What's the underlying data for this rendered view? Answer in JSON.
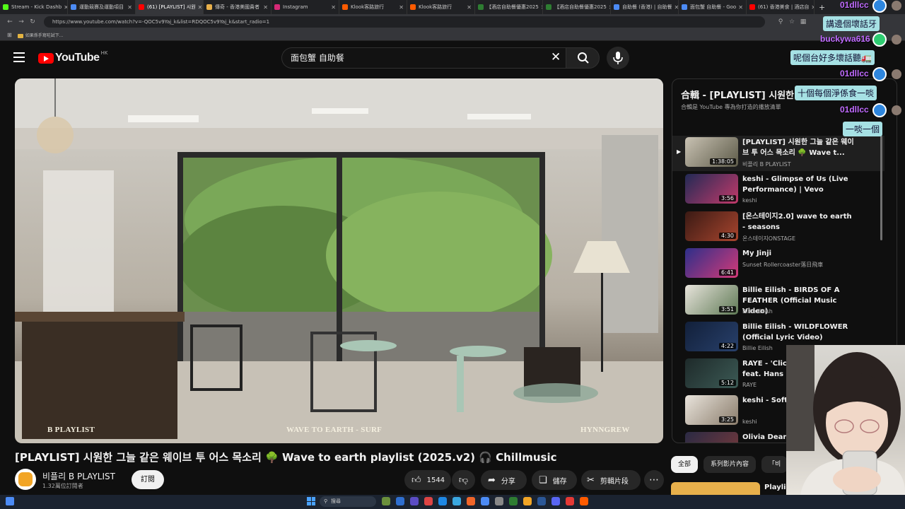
{
  "browser": {
    "tabs": [
      {
        "title": "Stream - Kick Dashb",
        "color": "#53fc18"
      },
      {
        "title": "運動競賽及運動項目",
        "color": "#4c8bf5"
      },
      {
        "title": "(61) [PLAYLIST] 시원",
        "color": "#ff0000",
        "active": true
      },
      {
        "title": "傳奇 - 香港美國貴者",
        "color": "#e8b04b"
      },
      {
        "title": "Instagram",
        "color": "#d62976"
      },
      {
        "title": "Klook客路旅行",
        "color": "#ff5b00"
      },
      {
        "title": "Klook客路旅行",
        "color": "#ff5b00"
      },
      {
        "title": "【酒店自助餐優惠2025",
        "color": "#2e7d32"
      },
      {
        "title": "【酒店自助餐優惠2025",
        "color": "#2e7d32"
      },
      {
        "title": "自助餐 (香港) | 自助餐",
        "color": "#4c8bf5"
      },
      {
        "title": "面包蟹 自助餐 - Goo",
        "color": "#4c8bf5"
      },
      {
        "title": "(61) 香港美食 | 酒店自",
        "color": "#ff0000"
      }
    ],
    "url": "https://www.youtube.com/watch?v=-QOC5v9Yaj_k&list=RDQOC5v9Yaj_k&start_radio=1",
    "bookmark": "如果係手寫咗試下..."
  },
  "youtube": {
    "logo_text": "YouTube",
    "region": "HK",
    "search_value": "面包蟹 自助餐",
    "video": {
      "overlay_left": "B PLAYLIST",
      "overlay_center": "WAVE TO EARTH - SURF",
      "overlay_right": "HYNNGREW",
      "title": "[PLAYLIST] 시원한 그늘 같은 웨이브 투 어스 목소리 🌳 Wave to earth playlist (2025.v2) 🎧 Chillmusic",
      "channel": "비플리 B PLAYLIST",
      "subscribers": "1.32萬位訂閱者",
      "subscribe": "訂閱",
      "likes": "1544",
      "share": "分享",
      "save": "儲存",
      "clip": "剪輯片段"
    },
    "playlist": {
      "title": "合輯 - [PLAYLIST] 시원한 그늘 같은",
      "subtitle": "合輯是 YouTube 專為你打造的播放清單",
      "items": [
        {
          "title": "[PLAYLIST] 시원한 그늘 같은 웨이브 투 어스 목소리 🌳 Wave t...",
          "channel": "비플리 B PLAYLIST",
          "duration": "1:38:05",
          "color1": "#c9c2b3",
          "color2": "#5c5a48"
        },
        {
          "title": "keshi - Glimpse of Us (Live Performance) | Vevo",
          "channel": "keshi",
          "duration": "3:56",
          "color1": "#222a55",
          "color2": "#c23a6a"
        },
        {
          "title": "[온스테이지2.0] wave to earth - seasons",
          "channel": "온스테이지ONSTAGE",
          "duration": "4:30",
          "color1": "#3a1a14",
          "color2": "#a8452e"
        },
        {
          "title": "My Jinji",
          "channel": "Sunset Rollercoaster落日飛車",
          "duration": "6:41",
          "color1": "#2d2f8a",
          "color2": "#d43a78"
        },
        {
          "title": "Billie Eilish - BIRDS OF A FEATHER (Official Music Video)",
          "channel": "Billie Eilish",
          "duration": "3:51",
          "color1": "#e8e4dc",
          "color2": "#5f7a55"
        },
        {
          "title": "Billie Eilish - WILDFLOWER (Official Lyric Video)",
          "channel": "Billie Eilish",
          "duration": "4:22",
          "color1": "#12203a",
          "color2": "#28406b"
        },
        {
          "title": "RAYE - 'Click Clack Sym... feat. Hans Zimmer (Of...",
          "channel": "RAYE",
          "duration": "5:12",
          "color1": "#1e2a2a",
          "color2": "#3c5a55"
        },
        {
          "title": "keshi - Soft S... Video)",
          "channel": "keshi",
          "duration": "3:25",
          "color1": "#e9e4dc",
          "color2": "#8a7c6b"
        },
        {
          "title": "Olivia Dean - ...",
          "channel": "",
          "duration": "",
          "color1": "#2a2a44",
          "color2": "#7a3a3a"
        }
      ]
    },
    "chips": [
      "全部",
      "系列影片內容",
      "「비"
    ],
    "next_card_title": "Playlis"
  },
  "chat": [
    {
      "name": "01dllcc",
      "message": "講邊個壞話牙"
    },
    {
      "name": "buckywa616",
      "message": "呢個台好多壞話聽🚛"
    },
    {
      "name": "01dllcc",
      "message": "十個每個淨係食一啖"
    },
    {
      "name": "01dllcc",
      "message": "一啖一個"
    }
  ],
  "taskbar": {
    "search": "搜尋"
  },
  "colors": {
    "bg": "#0f0f0f",
    "chat_name": "#c06bff",
    "chat_bubble": "#a6e1e4",
    "yt_red": "#ff0000"
  }
}
